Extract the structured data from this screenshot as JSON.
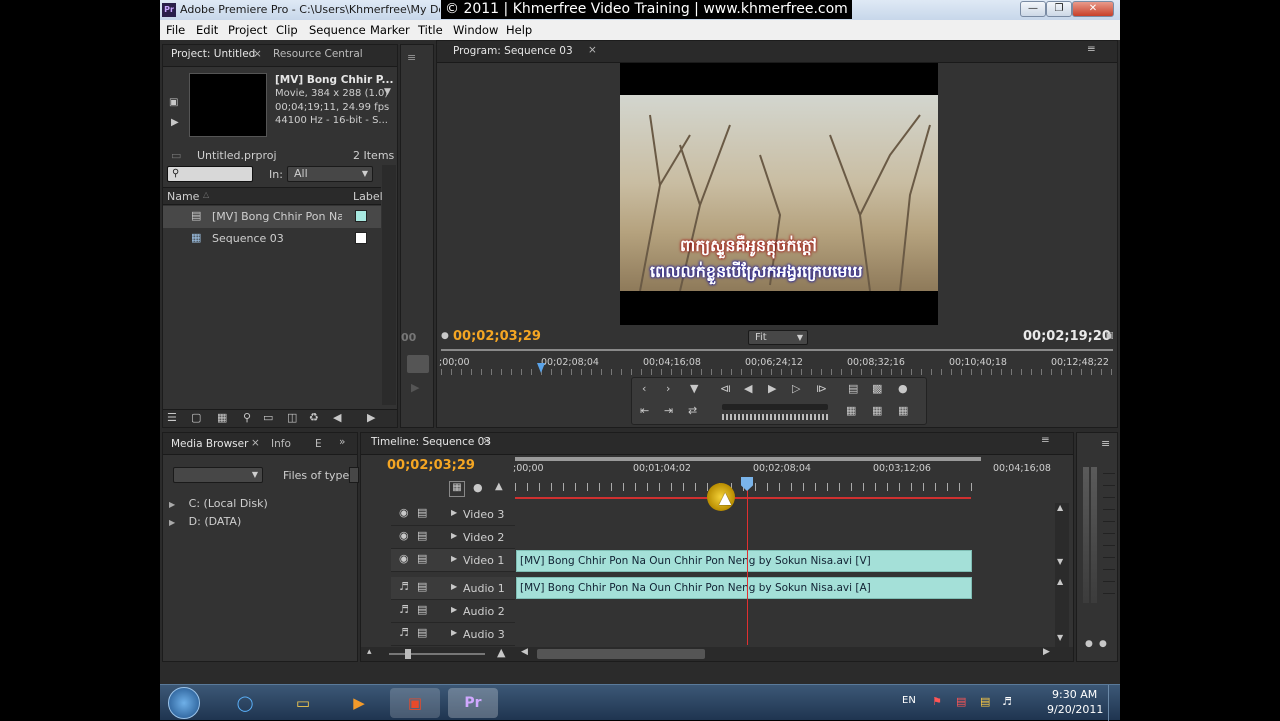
{
  "window": {
    "title": "Adobe Premiere Pro - C:\\Users\\Khmerfree\\My Docu",
    "watermark": "© 2011 | Khmerfree Video Training | www.khmerfree.com",
    "app_icon": "Pr"
  },
  "menu": [
    "File",
    "Edit",
    "Project",
    "Clip",
    "Sequence",
    "Marker",
    "Title",
    "Window",
    "Help"
  ],
  "project_panel": {
    "tabs": [
      "Project: Untitled",
      "Resource Central"
    ],
    "clip_name": "[MV] Bong Chhir P...",
    "clip_info": [
      "Movie, 384 x 288 (1.0)",
      "00;04;19;11, 24.99 fps",
      "44100 Hz - 16-bit - S..."
    ],
    "project_file": "Untitled.prproj",
    "item_count": "2 Items",
    "in_label": "In:",
    "in_value": "All",
    "col_name": "Name",
    "col_label": "Label",
    "items": [
      {
        "name": "[MV] Bong Chhir Pon Na Ou",
        "color": "#a8e8e0"
      },
      {
        "name": "Sequence 03",
        "color": "#ffffff"
      }
    ]
  },
  "program_monitor": {
    "tab": "Program: Sequence 03",
    "current_time": "00;02;03;29",
    "duration": "00;02;19;20",
    "zoom": "Fit",
    "ruler": ";00;00|00;02;08;04|00;04;16;08|00;06;24;12|00;08;32;16|00;10;40;18|00;12;48;22",
    "edge_time": "00",
    "subtitle_line1": "ពាក្យស្ទួនគឺអូនក្ដុចក់ក្ដៅ",
    "subtitle_line2": "ពេលលក់ខ្លួនបើស្រែកអង្វរក្រេបមេឃ"
  },
  "media_panel": {
    "tabs": [
      "Media Browser",
      "Info",
      "E"
    ],
    "files_of_type": "Files of type:",
    "drives": [
      "C: (Local Disk)",
      "D: (DATA)"
    ]
  },
  "timeline": {
    "tab": "Timeline: Sequence 03",
    "current_time": "00;02;03;29",
    "ruler": ";00;00|00;01;04;02|00;02;08;04|00;03;12;06|00;04;16;08",
    "tracks": {
      "video": [
        "Video 3",
        "Video 2",
        "Video 1"
      ],
      "audio": [
        "Audio 1",
        "Audio 2",
        "Audio 3"
      ]
    },
    "video_clip": "[MV] Bong Chhir Pon Na Oun Chhir Pon Neng by Sokun Nisa.avi [V]",
    "audio_clip": "[MV] Bong Chhir Pon Na Oun Chhir Pon Neng by Sokun Nisa.avi [A]"
  },
  "taskbar": {
    "lang": "EN",
    "time": "9:30 AM",
    "date": "9/20/2011"
  }
}
